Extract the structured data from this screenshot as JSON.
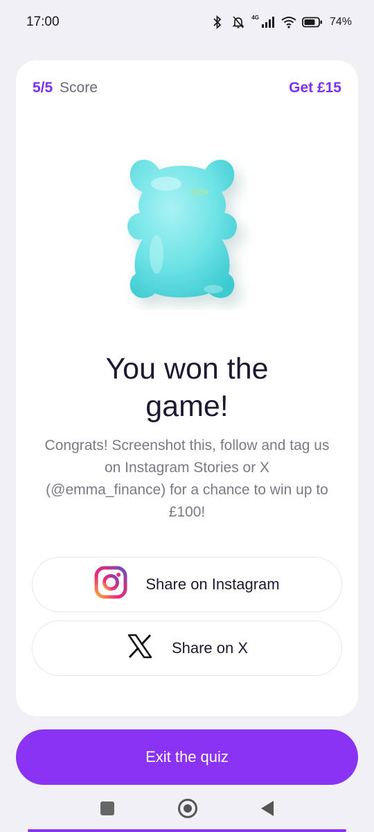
{
  "status_bar": {
    "time": "17:00",
    "network": "4G",
    "battery": "74%",
    "icons": [
      "bluetooth-icon",
      "mute-bell-icon",
      "signal-icon",
      "wifi-icon",
      "battery-icon"
    ]
  },
  "card": {
    "score_value": "5/5",
    "score_label": "Score",
    "reward": "Get £15",
    "image": "gummy-bear-icon",
    "title_line1": "You won the",
    "title_line2": "game!",
    "subtitle": "Congrats! Screenshot this, follow and tag us on Instagram Stories or X (@emma_finance) for a chance to win up to £100!",
    "share_instagram_label": "Share on Instagram",
    "share_x_label": "Share on X"
  },
  "exit_label": "Exit the quiz",
  "colors": {
    "accent": "#8a33f5",
    "bear": "#6fe3e6",
    "background": "#f1f0f6"
  },
  "nav": [
    "recent-apps-icon",
    "home-icon",
    "back-icon"
  ]
}
